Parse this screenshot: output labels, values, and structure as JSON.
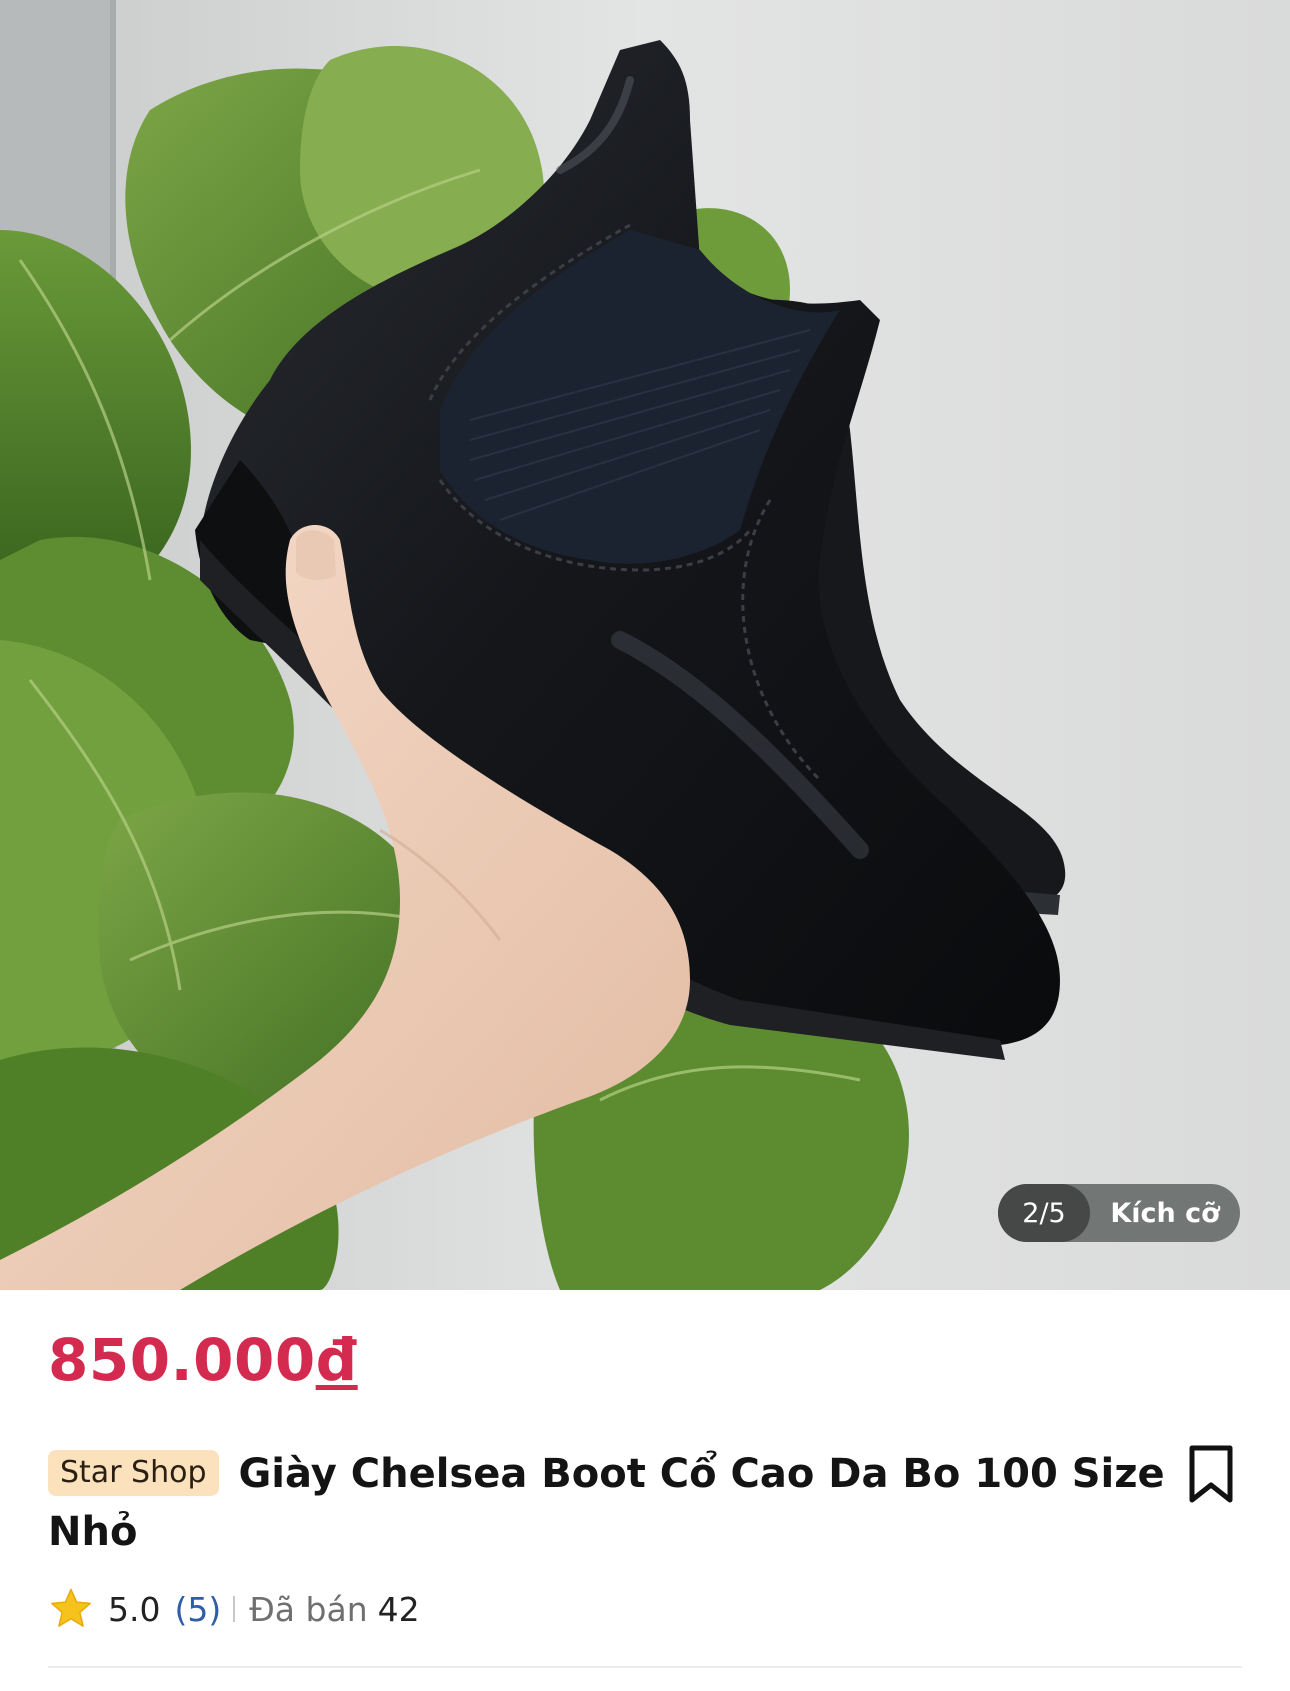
{
  "gallery": {
    "counter": "2/5",
    "size_chip_label": "Kích cỡ"
  },
  "product": {
    "price_amount": "850.000",
    "price_currency": "đ",
    "shop_badge": "Star Shop",
    "title": "Giày Chelsea Boot Cổ Cao Da Bo 100 Size Nhỏ",
    "rating": "5.0",
    "review_count": "(5)",
    "sold_label": "Đã bán",
    "sold_count": "42"
  },
  "icons": {
    "rating": "star-icon",
    "save": "bookmark-icon"
  },
  "colors": {
    "price": "#d42a4f",
    "shop_badge_bg": "#fbe2bd",
    "review_link": "#2f5ea8",
    "star": "#f6c21c"
  }
}
